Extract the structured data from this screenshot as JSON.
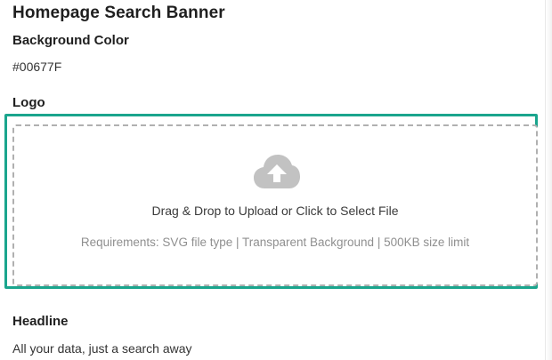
{
  "banner": {
    "title": "Homepage Search Banner"
  },
  "background_color": {
    "label": "Background Color",
    "value": "#00677F"
  },
  "logo": {
    "label": "Logo",
    "dropzone": {
      "icon": "cloud-upload-icon",
      "instruction": "Drag & Drop to Upload or Click to Select File",
      "requirements": "Requirements: SVG file type | Transparent Background | 500KB size limit"
    }
  },
  "headline": {
    "label": "Headline",
    "value": "All your data, just a search away"
  },
  "colors": {
    "highlight": "#1aa58d",
    "dashed_border": "#b0b0b0",
    "icon": "#c2c2c2"
  }
}
